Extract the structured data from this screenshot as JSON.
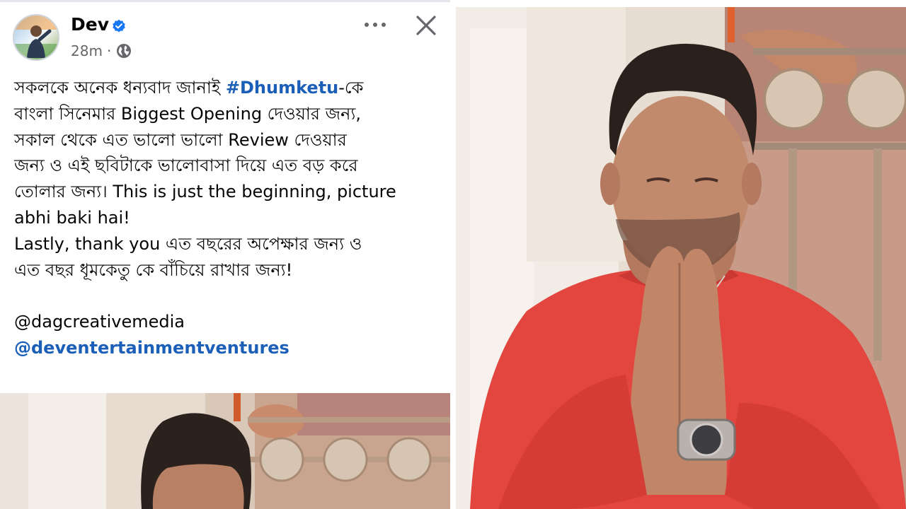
{
  "post": {
    "author": "Dev",
    "time": "28m",
    "separator": "·",
    "icons": {
      "verified": "verified-badge-icon",
      "audience": "globe-icon",
      "more": "more-options-icon",
      "close": "close-icon"
    },
    "colors": {
      "link": "#1b5fb8",
      "verified": "#1877f2",
      "meta": "#65676b",
      "kurta": "#e2463f"
    },
    "text": {
      "line1_a": "সকলকে অনেক ধন্যবাদ জানাই ",
      "line1_hashtag": "#Dhumketu",
      "line1_b": "-কে",
      "line2": "বাংলা সিনেমার Biggest Opening দেওয়ার জন্য,",
      "line3": "সকাল থেকে এত ভালো ভালো Review দেওয়ার",
      "line4": "জন্য ও এই ছবিটাকে ভালোবাসা দিয়ে এত বড় করে",
      "line5": "তোলার জন্য। This is just the beginning, picture",
      "line6": "abhi baki hai!",
      "line7": "Lastly, thank you এত বছরের অপেক্ষার জন্য ও",
      "line8": "এত বছর ধূমকেতু কে বাঁচিয়ে রাখার জন্য!",
      "mention1": "@dagcreativemedia",
      "mention2": "@deventertainmentventures"
    }
  }
}
